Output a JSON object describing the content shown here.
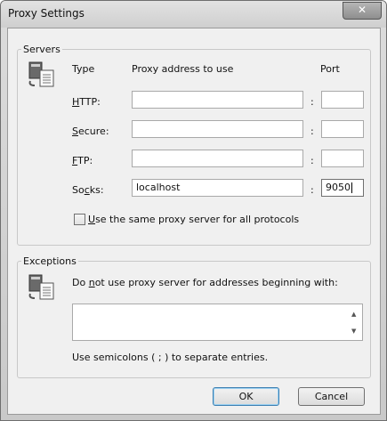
{
  "window": {
    "title": "Proxy Settings",
    "close_glyph": "✕"
  },
  "servers": {
    "legend": "Servers",
    "icon": "proxy-server-icon",
    "col_type": "Type",
    "col_address": "Proxy address to use",
    "col_port": "Port",
    "colon": ":",
    "rows": [
      {
        "key": "http",
        "label_access": "H",
        "label_rest": "TTP:",
        "address": "",
        "port": ""
      },
      {
        "key": "secure",
        "label_access": "S",
        "label_rest": "ecure:",
        "address": "",
        "port": ""
      },
      {
        "key": "ftp",
        "label_access": "F",
        "label_rest": "TP:",
        "address": "",
        "port": ""
      },
      {
        "key": "socks",
        "label_pre": "So",
        "label_access": "c",
        "label_rest": "ks:",
        "address": "localhost",
        "port": "9050"
      }
    ],
    "same_proxy": {
      "access": "U",
      "rest": "se the same proxy server for all protocols",
      "checked": false
    }
  },
  "exceptions": {
    "legend": "Exceptions",
    "icon": "proxy-server-icon",
    "desc_pre": "Do ",
    "desc_access": "n",
    "desc_rest": "ot use proxy server for addresses beginning with:",
    "value": "",
    "hint": "Use semicolons ( ; ) to separate entries."
  },
  "buttons": {
    "ok": "OK",
    "cancel": "Cancel"
  }
}
